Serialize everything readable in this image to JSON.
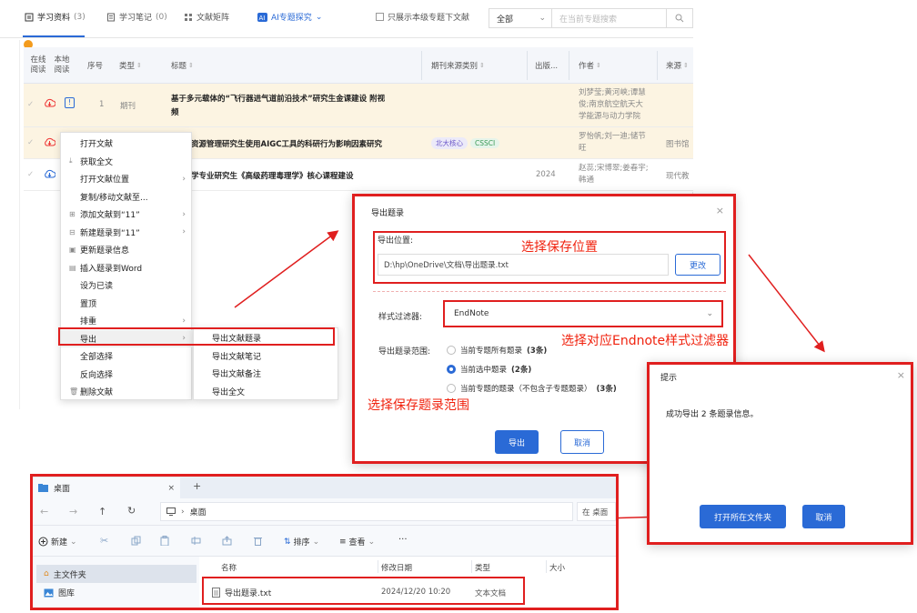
{
  "tabs": [
    {
      "label": "学习资料",
      "count": "(3)"
    },
    {
      "label": "学习笔记",
      "count": "(0)"
    },
    {
      "label": "文献矩阵",
      "count": ""
    },
    {
      "label": "AI专题探究",
      "count": ""
    }
  ],
  "filter": {
    "only_current_label": "只展示本级专题下文献",
    "scope_value": "全部",
    "search_placeholder": "在当前专题搜索"
  },
  "table": {
    "headers": {
      "online_read": "在线阅读",
      "local_read": "本地阅读",
      "index": "序号",
      "type": "类型",
      "title": "标题",
      "source_category": "期刊来源类别",
      "year": "出版...",
      "author": "作者",
      "source": "来源"
    },
    "rows": [
      {
        "index": "1",
        "type": "期刊",
        "title_line1": "基于多元载体的“飞行器进气道前沿技术”研究生金课建设 附视",
        "title_line2": "频",
        "tags": [],
        "year": "",
        "author_lines": [
          "刘梦莹;黄河峡;谭慧",
          "俊;南京航空航天大",
          "学能源与动力学院"
        ],
        "source": ""
      },
      {
        "index": "",
        "type": "",
        "title_line1": "资源管理研究生使用AIGC工具的科研行为影响因素研究",
        "title_line2": "",
        "tags": [
          "北大核心",
          "CSSCI"
        ],
        "year": "",
        "author_lines": [
          "罗怡帆;刘一迪;储节",
          "旺"
        ],
        "source": "图书馆"
      },
      {
        "index": "",
        "type": "",
        "title_line1": "学专业研究生《高级药理毒理学》核心课程建设",
        "title_line2": "",
        "tags": [],
        "year": "2024",
        "author_lines": [
          "赵蕊;宋博翠;姜春宇;",
          "韩通"
        ],
        "source": "现代教"
      }
    ]
  },
  "context_menu": {
    "items": [
      {
        "label": "打开文献",
        "icon": "",
        "arrow": false
      },
      {
        "label": "获取全文",
        "icon": "download-icon",
        "arrow": false
      },
      {
        "label": "打开文献位置",
        "icon": "",
        "arrow": true
      },
      {
        "label": "复制/移动文献至...",
        "icon": "",
        "arrow": false
      },
      {
        "label": "添加文献到“11”",
        "icon": "add-doc-icon",
        "arrow": true
      },
      {
        "label": "新建题录到“11”",
        "icon": "new-entry-icon",
        "arrow": true
      },
      {
        "label": "更新题录信息",
        "icon": "refresh-entry-icon",
        "arrow": false
      },
      {
        "label": "插入题录到Word",
        "icon": "word-icon",
        "arrow": false
      },
      {
        "label": "设为已读",
        "icon": "",
        "arrow": false
      },
      {
        "label": "置顶",
        "icon": "",
        "arrow": false
      },
      {
        "label": "排重",
        "icon": "",
        "arrow": true
      },
      {
        "label": "导出",
        "icon": "",
        "arrow": true
      },
      {
        "label": "全部选择",
        "icon": "",
        "arrow": false
      },
      {
        "label": "反向选择",
        "icon": "",
        "arrow": false
      },
      {
        "label": "删除文献",
        "icon": "trash-icon",
        "arrow": false
      }
    ],
    "submenu": [
      "导出文献题录",
      "导出文献笔记",
      "导出文献备注",
      "导出全文"
    ]
  },
  "export_dialog": {
    "title": "导出题录",
    "location_label": "导出位置:",
    "path_value": "D:\\hp\\OneDrive\\文档\\导出题录.txt",
    "change_button": "更改",
    "style_label": "样式过滤器:",
    "style_value": "EndNote",
    "range_label": "导出题录范围:",
    "range_options": [
      {
        "label": "当前专题所有题录",
        "count": "(3条)",
        "selected": false
      },
      {
        "label": "当前选中题录",
        "count": "(2条)",
        "selected": true
      },
      {
        "label": "当前专题的题录（不包含子专题题录）",
        "count": "(3条)",
        "selected": false
      }
    ],
    "export_button": "导出",
    "cancel_button": "取消"
  },
  "annotations": {
    "save_location": "选择保存位置",
    "style_filter": "选择对应Endnote样式过滤器",
    "range": "选择保存题录范围"
  },
  "tip_dialog": {
    "title": "提示",
    "message": "成功导出 2 条题录信息。",
    "open_folder_button": "打开所在文件夹",
    "cancel_button": "取消"
  },
  "explorer": {
    "tab_title": "桌面",
    "address": "桌面",
    "search_placeholder": "在 桌面",
    "toolbar": {
      "new": "新建",
      "sort": "排序",
      "view": "查看",
      "more": "···"
    },
    "sidebar": [
      "主文件夹",
      "图库"
    ],
    "columns": [
      "名称",
      "修改日期",
      "类型",
      "大小"
    ],
    "file": {
      "name": "导出题录.txt",
      "date": "2024/12/20 10:20",
      "type": "文本文档",
      "size": ""
    }
  },
  "colors": {
    "accent": "#2a6ad6",
    "annotation_red": "#e01f1f",
    "selected_row": "#fcf4e2"
  }
}
